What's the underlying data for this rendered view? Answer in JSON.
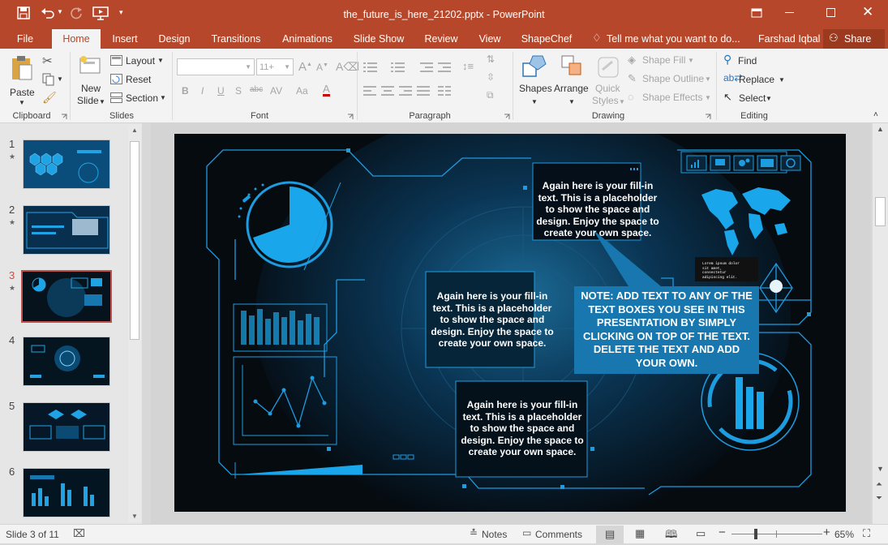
{
  "app": {
    "doc_title": "the_future_is_here_21202.pptx - PowerPoint",
    "user": "Farshad Iqbal",
    "share": "Share",
    "tell_me": "Tell me what you want to do..."
  },
  "tabs": [
    "File",
    "Home",
    "Insert",
    "Design",
    "Transitions",
    "Animations",
    "Slide Show",
    "Review",
    "View",
    "ShapeChef"
  ],
  "active_tab": "Home",
  "ribbon": {
    "clipboard": {
      "label": "Clipboard",
      "paste": "Paste"
    },
    "slides": {
      "label": "Slides",
      "new_slide": "New",
      "new_slide2": "Slide",
      "layout": "Layout",
      "reset": "Reset",
      "section": "Section"
    },
    "font": {
      "label": "Font",
      "font_name": "",
      "font_size": "11+",
      "bold": "B",
      "italic": "I",
      "underline": "U",
      "shadow": "S",
      "strike": "abc",
      "spacing": "AV",
      "case": "Aa"
    },
    "paragraph": {
      "label": "Paragraph"
    },
    "drawing": {
      "label": "Drawing",
      "shapes": "Shapes",
      "arrange": "Arrange",
      "quick_styles": "Quick",
      "quick_styles2": "Styles",
      "shape_fill": "Shape Fill",
      "shape_outline": "Shape Outline",
      "shape_effects": "Shape Effects"
    },
    "editing": {
      "label": "Editing",
      "find": "Find",
      "replace": "Replace",
      "select": "Select"
    }
  },
  "thumbnails": [
    {
      "num": "1",
      "star": "★"
    },
    {
      "num": "2",
      "star": "★"
    },
    {
      "num": "3",
      "star": "★",
      "selected": true
    },
    {
      "num": "4",
      "star": ""
    },
    {
      "num": "5",
      "star": ""
    },
    {
      "num": "6",
      "star": ""
    }
  ],
  "slide": {
    "fill_text": "Again here is your fill-in text. This is a placeholder to show the space and design. Enjoy the space to create your own space.",
    "note_text": "NOTE: ADD TEXT TO ANY OF THE TEXT BOXES YOU SEE IN THIS PRESENTATION BY SIMPLY CLICKING ON TOP OF THE TEXT. DELETE THE TEXT AND ADD YOUR OWN.",
    "code_lines": [
      "Lorem ipsum dolor",
      "sit amet,",
      "consectetur",
      "adipiscing elit."
    ]
  },
  "status": {
    "slide_info": "Slide 3 of 11",
    "notes": "Notes",
    "comments": "Comments",
    "zoom": "65%"
  },
  "colors": {
    "accent": "#b7472a",
    "slide_blue": "#1e9ce0",
    "note_bg": "#1777ae"
  }
}
